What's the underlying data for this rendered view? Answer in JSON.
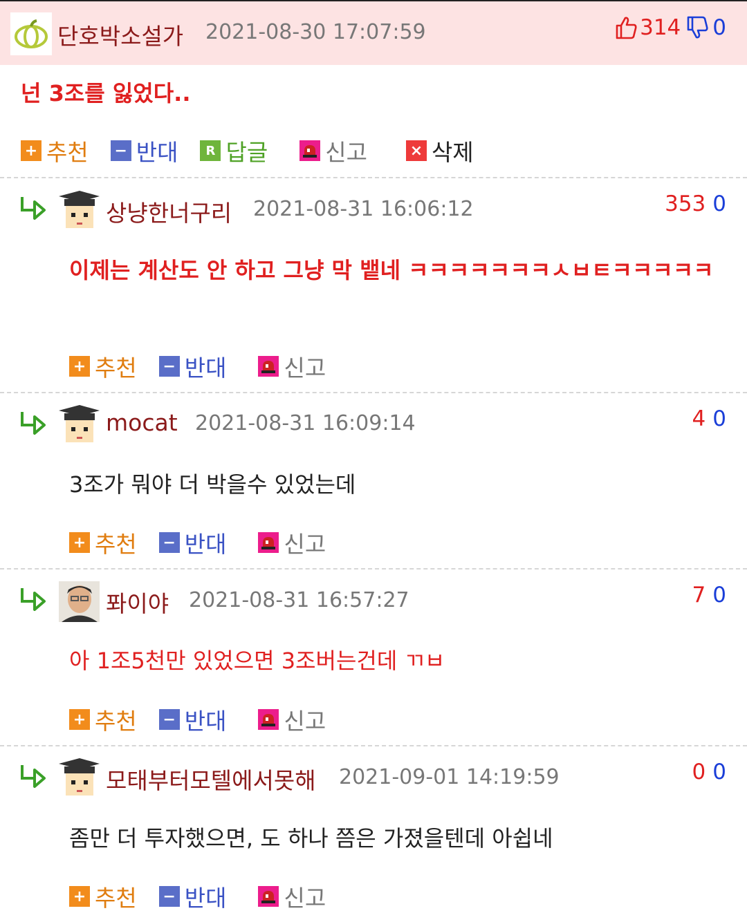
{
  "post": {
    "nick": "단호박소설가",
    "date": "2021-08-30 17:07:59",
    "up": "314",
    "down": "0",
    "content": "넌 3조를 잃었다..",
    "actions": {
      "recommend": "추천",
      "oppose": "반대",
      "reply": "답글",
      "report": "신고",
      "delete": "삭제"
    }
  },
  "comments": [
    {
      "nick": "상냥한너구리",
      "date": "2021-08-31 16:06:12",
      "up": "353",
      "down": "0",
      "content": "이제는 계산도 안 하고 그냥 막 뱉네 ㅋㅋㅋㅋㅋㅋㅋㅅㅂㅌㅋㅋㅋㅋㅋ"
    },
    {
      "nick": "mocat",
      "date": "2021-08-31 16:09:14",
      "up": "4",
      "down": "0",
      "content": "3조가 뭐야 더 박을수 있었는데"
    },
    {
      "nick": "퐈이야",
      "date": "2021-08-31 16:57:27",
      "up": "7",
      "down": "0",
      "content": "아 1조5천만 있었으면 3조버는건데 ㄲㅂ"
    },
    {
      "nick": "모태부터모텔에서못해",
      "date": "2021-09-01 14:19:59",
      "up": "0",
      "down": "0",
      "content": "좀만 더 투자했으면, 도 하나 쯤은 가졌을텐데 아쉽네"
    }
  ],
  "comment_actions": {
    "recommend": "추천",
    "oppose": "반대",
    "report": "신고"
  },
  "icons": {
    "avatar_onion": "onion-avatar-icon",
    "thumbs_up": "thumbs-up-icon",
    "thumbs_down": "thumbs-down-icon",
    "reply_arrow": "reply-arrow-icon",
    "graduate_avatar": "graduate-avatar-icon",
    "photo_avatar": "photo-avatar-icon"
  },
  "colors": {
    "nick": "#8b1a1a",
    "up": "#e02020",
    "down": "#1a3ed8",
    "header_bg": "#fde3e3"
  }
}
